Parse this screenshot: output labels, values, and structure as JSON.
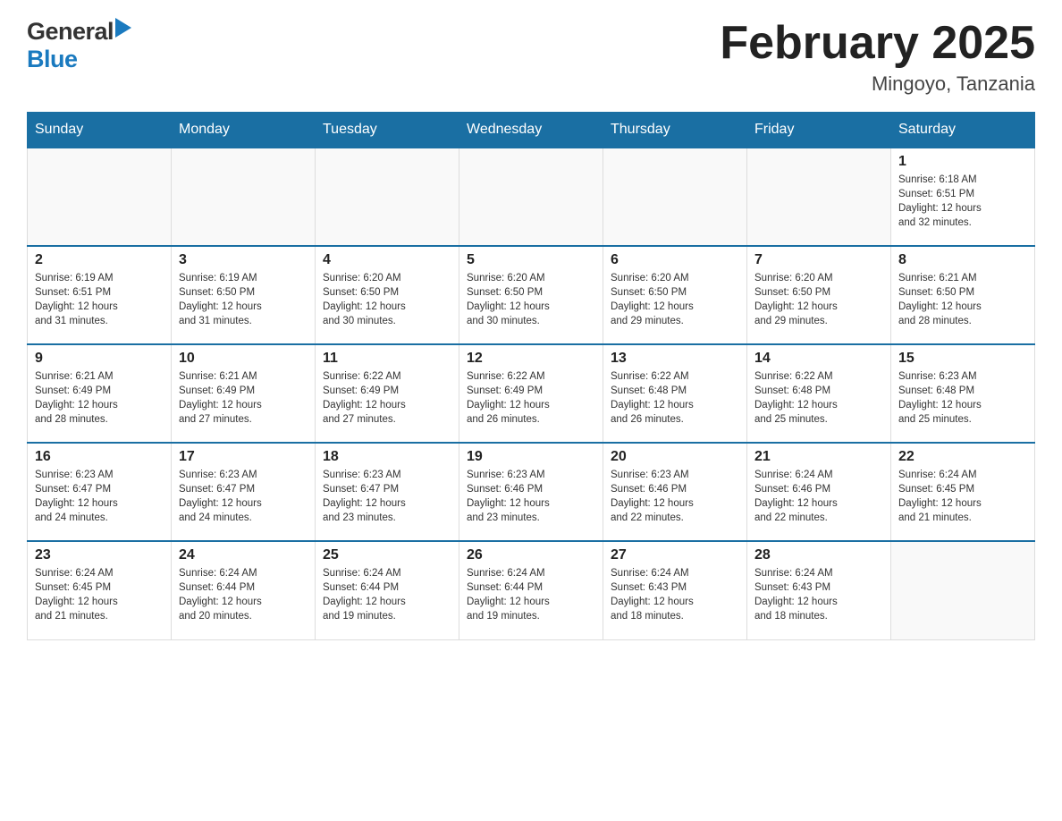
{
  "header": {
    "logo_general": "General",
    "logo_blue": "Blue",
    "month_title": "February 2025",
    "location": "Mingoyo, Tanzania"
  },
  "days_of_week": [
    "Sunday",
    "Monday",
    "Tuesday",
    "Wednesday",
    "Thursday",
    "Friday",
    "Saturday"
  ],
  "weeks": [
    {
      "days": [
        {
          "number": "",
          "info": ""
        },
        {
          "number": "",
          "info": ""
        },
        {
          "number": "",
          "info": ""
        },
        {
          "number": "",
          "info": ""
        },
        {
          "number": "",
          "info": ""
        },
        {
          "number": "",
          "info": ""
        },
        {
          "number": "1",
          "info": "Sunrise: 6:18 AM\nSunset: 6:51 PM\nDaylight: 12 hours\nand 32 minutes."
        }
      ]
    },
    {
      "days": [
        {
          "number": "2",
          "info": "Sunrise: 6:19 AM\nSunset: 6:51 PM\nDaylight: 12 hours\nand 31 minutes."
        },
        {
          "number": "3",
          "info": "Sunrise: 6:19 AM\nSunset: 6:50 PM\nDaylight: 12 hours\nand 31 minutes."
        },
        {
          "number": "4",
          "info": "Sunrise: 6:20 AM\nSunset: 6:50 PM\nDaylight: 12 hours\nand 30 minutes."
        },
        {
          "number": "5",
          "info": "Sunrise: 6:20 AM\nSunset: 6:50 PM\nDaylight: 12 hours\nand 30 minutes."
        },
        {
          "number": "6",
          "info": "Sunrise: 6:20 AM\nSunset: 6:50 PM\nDaylight: 12 hours\nand 29 minutes."
        },
        {
          "number": "7",
          "info": "Sunrise: 6:20 AM\nSunset: 6:50 PM\nDaylight: 12 hours\nand 29 minutes."
        },
        {
          "number": "8",
          "info": "Sunrise: 6:21 AM\nSunset: 6:50 PM\nDaylight: 12 hours\nand 28 minutes."
        }
      ]
    },
    {
      "days": [
        {
          "number": "9",
          "info": "Sunrise: 6:21 AM\nSunset: 6:49 PM\nDaylight: 12 hours\nand 28 minutes."
        },
        {
          "number": "10",
          "info": "Sunrise: 6:21 AM\nSunset: 6:49 PM\nDaylight: 12 hours\nand 27 minutes."
        },
        {
          "number": "11",
          "info": "Sunrise: 6:22 AM\nSunset: 6:49 PM\nDaylight: 12 hours\nand 27 minutes."
        },
        {
          "number": "12",
          "info": "Sunrise: 6:22 AM\nSunset: 6:49 PM\nDaylight: 12 hours\nand 26 minutes."
        },
        {
          "number": "13",
          "info": "Sunrise: 6:22 AM\nSunset: 6:48 PM\nDaylight: 12 hours\nand 26 minutes."
        },
        {
          "number": "14",
          "info": "Sunrise: 6:22 AM\nSunset: 6:48 PM\nDaylight: 12 hours\nand 25 minutes."
        },
        {
          "number": "15",
          "info": "Sunrise: 6:23 AM\nSunset: 6:48 PM\nDaylight: 12 hours\nand 25 minutes."
        }
      ]
    },
    {
      "days": [
        {
          "number": "16",
          "info": "Sunrise: 6:23 AM\nSunset: 6:47 PM\nDaylight: 12 hours\nand 24 minutes."
        },
        {
          "number": "17",
          "info": "Sunrise: 6:23 AM\nSunset: 6:47 PM\nDaylight: 12 hours\nand 24 minutes."
        },
        {
          "number": "18",
          "info": "Sunrise: 6:23 AM\nSunset: 6:47 PM\nDaylight: 12 hours\nand 23 minutes."
        },
        {
          "number": "19",
          "info": "Sunrise: 6:23 AM\nSunset: 6:46 PM\nDaylight: 12 hours\nand 23 minutes."
        },
        {
          "number": "20",
          "info": "Sunrise: 6:23 AM\nSunset: 6:46 PM\nDaylight: 12 hours\nand 22 minutes."
        },
        {
          "number": "21",
          "info": "Sunrise: 6:24 AM\nSunset: 6:46 PM\nDaylight: 12 hours\nand 22 minutes."
        },
        {
          "number": "22",
          "info": "Sunrise: 6:24 AM\nSunset: 6:45 PM\nDaylight: 12 hours\nand 21 minutes."
        }
      ]
    },
    {
      "days": [
        {
          "number": "23",
          "info": "Sunrise: 6:24 AM\nSunset: 6:45 PM\nDaylight: 12 hours\nand 21 minutes."
        },
        {
          "number": "24",
          "info": "Sunrise: 6:24 AM\nSunset: 6:44 PM\nDaylight: 12 hours\nand 20 minutes."
        },
        {
          "number": "25",
          "info": "Sunrise: 6:24 AM\nSunset: 6:44 PM\nDaylight: 12 hours\nand 19 minutes."
        },
        {
          "number": "26",
          "info": "Sunrise: 6:24 AM\nSunset: 6:44 PM\nDaylight: 12 hours\nand 19 minutes."
        },
        {
          "number": "27",
          "info": "Sunrise: 6:24 AM\nSunset: 6:43 PM\nDaylight: 12 hours\nand 18 minutes."
        },
        {
          "number": "28",
          "info": "Sunrise: 6:24 AM\nSunset: 6:43 PM\nDaylight: 12 hours\nand 18 minutes."
        },
        {
          "number": "",
          "info": ""
        }
      ]
    }
  ]
}
